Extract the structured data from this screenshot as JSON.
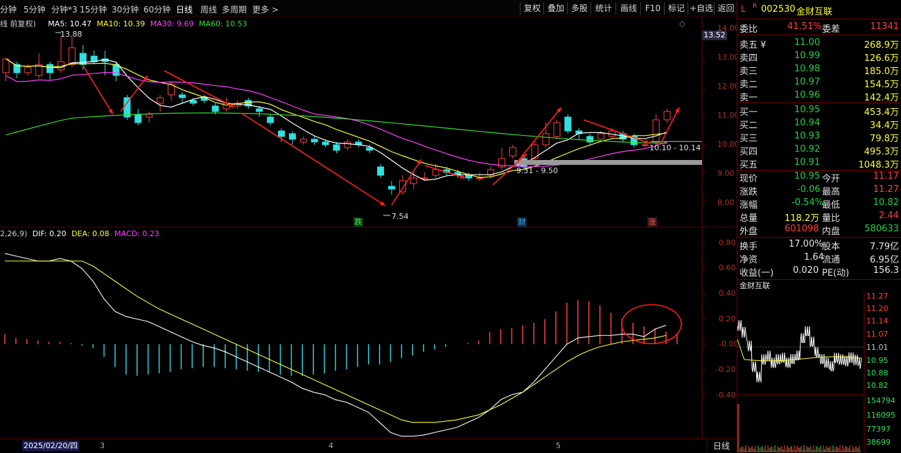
{
  "toolbar": {
    "periods": [
      "分钟",
      "5分钟",
      "分钟*3",
      "15分钟",
      "30分钟",
      "60分钟",
      "日线",
      "周线",
      "多周期",
      "更多 >"
    ],
    "active_period": "日线",
    "buttons": [
      "复权",
      "叠加",
      "多股",
      "统计",
      "画线",
      "F10",
      "标记",
      "+自选",
      "返回"
    ]
  },
  "kline_header": {
    "prefix": "线 前复权)",
    "ma5": "MA5: 10.47",
    "ma10": "MA10: 10.39",
    "ma30": "MA30: 9.69",
    "ma60": "MA60: 10.53",
    "high_label": "13.88",
    "low_label": "7.54",
    "range1": "9.31 - 9.50",
    "range2": "10.10 - 10.14",
    "current_price_tag": "13.52",
    "y_ticks": [
      "14.00",
      "13.00",
      "12.00",
      "11.00",
      "10.00",
      "9.00",
      "8.00"
    ],
    "event_marks": [
      "跌",
      "财",
      "涨"
    ]
  },
  "macd_header": {
    "prefix": "2,26,9)",
    "dif": "DIF: 0.20",
    "dea": "DEA: 0.08",
    "macd": "MACD: 0.23",
    "y_ticks": [
      "0.80",
      "0.60",
      "0.40",
      "0.20",
      "-0.00",
      "-0.20",
      "-0.40"
    ]
  },
  "date_bar": {
    "date": "2025/02/20/四",
    "months": [
      "3",
      "4",
      "5"
    ],
    "period_label": "日线"
  },
  "colors": {
    "up": "#ff4040",
    "down": "#30e0e0",
    "ma5": "#ffffff",
    "ma10": "#ffff30",
    "ma30": "#ff40ff",
    "ma60": "#30e030",
    "arrow": "#ff2020"
  },
  "chart_data": {
    "type": "candlestick",
    "candles": [
      [
        12.6,
        13.1,
        12.3,
        13.0
      ],
      [
        12.9,
        12.6,
        12.4,
        13.0
      ],
      [
        12.6,
        12.8,
        12.5,
        12.9
      ],
      [
        12.5,
        12.9,
        12.4,
        13.3
      ],
      [
        12.9,
        12.6,
        12.3,
        13.0
      ],
      [
        12.7,
        13.0,
        12.6,
        13.9
      ],
      [
        12.9,
        13.5,
        12.8,
        13.9
      ],
      [
        13.3,
        12.9,
        12.7,
        13.6
      ],
      [
        13.2,
        13.0,
        12.9,
        13.4
      ],
      [
        13.1,
        13.0,
        12.5,
        13.4
      ],
      [
        12.9,
        12.5,
        12.3,
        13.0
      ],
      [
        11.7,
        11.0,
        10.9,
        11.8
      ],
      [
        11.1,
        10.8,
        10.7,
        11.3
      ],
      [
        11.0,
        11.1,
        10.8,
        11.2
      ],
      [
        11.5,
        11.7,
        11.2,
        11.8
      ],
      [
        11.8,
        12.2,
        11.6,
        12.3
      ],
      [
        11.8,
        11.7,
        11.5,
        11.9
      ],
      [
        11.6,
        11.5,
        11.4,
        11.7
      ],
      [
        11.7,
        11.6,
        11.5,
        11.8
      ],
      [
        11.4,
        11.2,
        11.1,
        11.5
      ],
      [
        11.3,
        11.5,
        11.2,
        11.7
      ],
      [
        11.4,
        11.5,
        11.3,
        11.6
      ],
      [
        11.6,
        11.4,
        11.3,
        11.7
      ],
      [
        11.3,
        11.2,
        11.0,
        11.4
      ],
      [
        11.0,
        10.8,
        10.7,
        11.1
      ],
      [
        10.5,
        10.3,
        10.1,
        10.6
      ],
      [
        10.4,
        10.2,
        10.0,
        10.5
      ],
      [
        10.1,
        10.2,
        10.0,
        10.3
      ],
      [
        10.2,
        10.1,
        10.0,
        10.3
      ],
      [
        10.1,
        10.0,
        9.9,
        10.2
      ],
      [
        10.0,
        9.8,
        9.7,
        10.1
      ],
      [
        9.9,
        10.1,
        9.8,
        10.2
      ],
      [
        10.1,
        10.0,
        9.9,
        10.2
      ],
      [
        9.9,
        9.8,
        9.7,
        10.0
      ],
      [
        9.2,
        8.9,
        8.8,
        9.3
      ],
      [
        8.5,
        8.4,
        8.2,
        8.7
      ],
      [
        8.3,
        8.7,
        8.2,
        8.9
      ],
      [
        8.6,
        8.8,
        8.4,
        9.0
      ],
      [
        8.8,
        8.8,
        8.7,
        9.0
      ],
      [
        8.9,
        9.1,
        8.8,
        9.3
      ],
      [
        9.1,
        9.0,
        8.9,
        9.2
      ],
      [
        9.0,
        8.9,
        8.8,
        9.1
      ],
      [
        8.9,
        8.8,
        8.7,
        9.0
      ],
      [
        8.8,
        8.8,
        8.7,
        9.0
      ],
      [
        8.9,
        9.1,
        8.8,
        9.2
      ],
      [
        9.2,
        9.5,
        9.1,
        9.9
      ],
      [
        9.6,
        9.9,
        9.5,
        10.0
      ],
      [
        9.5,
        9.2,
        9.1,
        9.6
      ],
      [
        9.5,
        10.0,
        9.4,
        10.1
      ],
      [
        10.0,
        10.4,
        9.9,
        10.8
      ],
      [
        10.3,
        10.8,
        10.2,
        10.9
      ],
      [
        11.0,
        10.5,
        10.4,
        11.1
      ],
      [
        10.5,
        10.4,
        10.2,
        10.6
      ],
      [
        10.3,
        10.1,
        10.0,
        10.4
      ],
      [
        10.2,
        10.4,
        10.1,
        10.5
      ],
      [
        10.3,
        10.5,
        10.2,
        10.6
      ],
      [
        10.4,
        10.2,
        10.1,
        10.5
      ],
      [
        10.3,
        10.0,
        9.9,
        10.4
      ],
      [
        10.0,
        10.0,
        9.9,
        10.1
      ],
      [
        10.1,
        10.9,
        10.0,
        11.1
      ],
      [
        10.9,
        11.2,
        10.8,
        11.3
      ]
    ],
    "ylim": [
      7.5,
      14.2
    ]
  }
}
